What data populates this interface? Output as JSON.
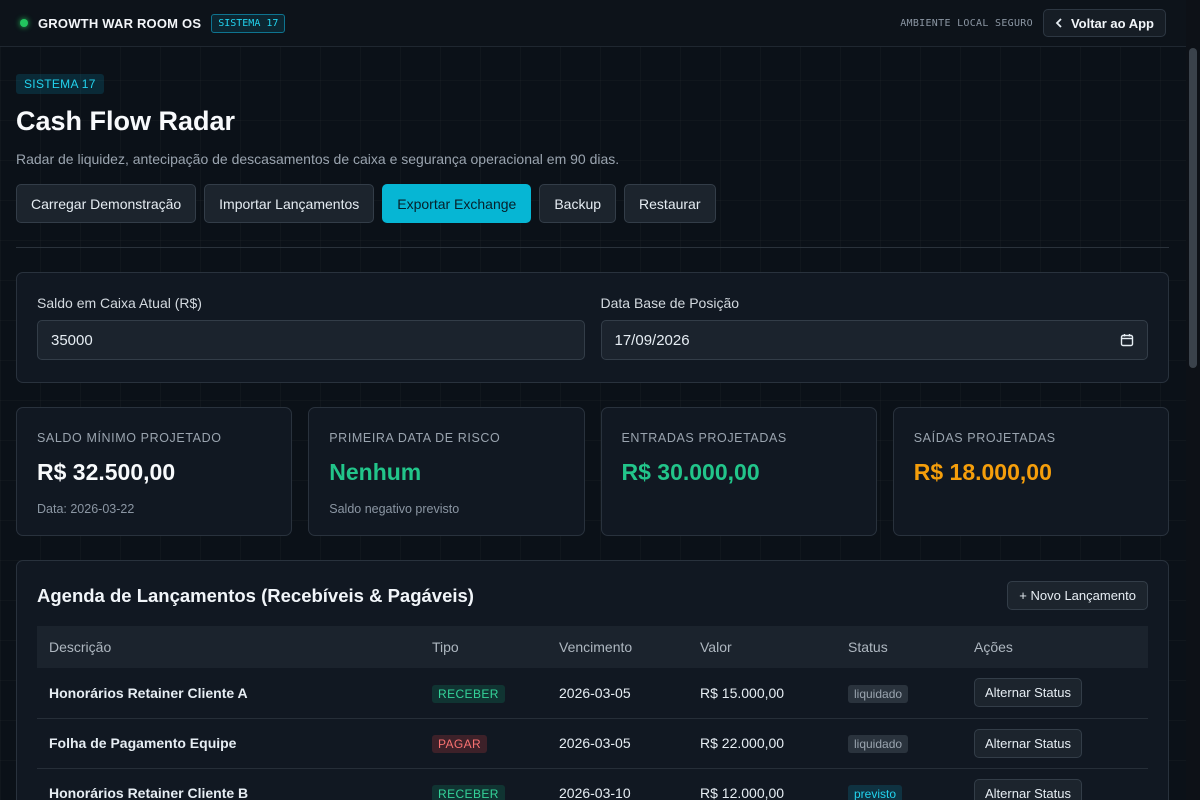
{
  "topbar": {
    "brand": "GROWTH WAR ROOM OS",
    "badge": "SISTEMA 17",
    "env": "AMBIENTE LOCAL SEGURO",
    "back_label": "Voltar ao App"
  },
  "header": {
    "badge": "SISTEMA 17",
    "title": "Cash Flow Radar",
    "subtitle": "Radar de liquidez, antecipação de descasamentos de caixa e segurança operacional em 90 dias."
  },
  "actions": {
    "demo": "Carregar Demonstração",
    "import": "Importar Lançamentos",
    "export": "Exportar Exchange",
    "backup": "Backup",
    "restore": "Restaurar"
  },
  "inputs": {
    "balance_label": "Saldo em Caixa Atual (R$)",
    "balance_value": "35000",
    "date_label": "Data Base de Posição",
    "date_value": "17/09/2026"
  },
  "kpis": [
    {
      "label": "SALDO MÍNIMO PROJETADO",
      "value": "R$ 32.500,00",
      "note": "Data: 2026-03-22"
    },
    {
      "label": "PRIMEIRA DATA DE RISCO",
      "value": "Nenhum",
      "note": "Saldo negativo previsto"
    },
    {
      "label": "ENTRADAS PROJETADAS",
      "value": "R$ 30.000,00",
      "note": ""
    },
    {
      "label": "SAÍDAS PROJETADAS",
      "value": "R$ 18.000,00",
      "note": ""
    }
  ],
  "agenda": {
    "title": "Agenda de Lançamentos (Recebíveis & Pagáveis)",
    "new_button": "+ Novo Lançamento",
    "columns": [
      "Descrição",
      "Tipo",
      "Vencimento",
      "Valor",
      "Status",
      "Ações"
    ],
    "rows": [
      {
        "desc": "Honorários Retainer Cliente A",
        "type": "RECEBER",
        "due": "2026-03-05",
        "value": "R$ 15.000,00",
        "status": "liquidado",
        "action": "Alternar Status"
      },
      {
        "desc": "Folha de Pagamento Equipe",
        "type": "PAGAR",
        "due": "2026-03-05",
        "value": "R$ 22.000,00",
        "status": "liquidado",
        "action": "Alternar Status"
      },
      {
        "desc": "Honorários Retainer Cliente B",
        "type": "RECEBER",
        "due": "2026-03-10",
        "value": "R$ 12.000,00",
        "status": "previsto",
        "action": "Alternar Status"
      }
    ]
  },
  "colors": {
    "accent": "#06b6d4",
    "positive": "#22c58a",
    "warning": "#f59e0b"
  },
  "icons": {
    "status_dot": "status-dot",
    "back": "chevron-left-icon",
    "calendar": "calendar-icon"
  }
}
